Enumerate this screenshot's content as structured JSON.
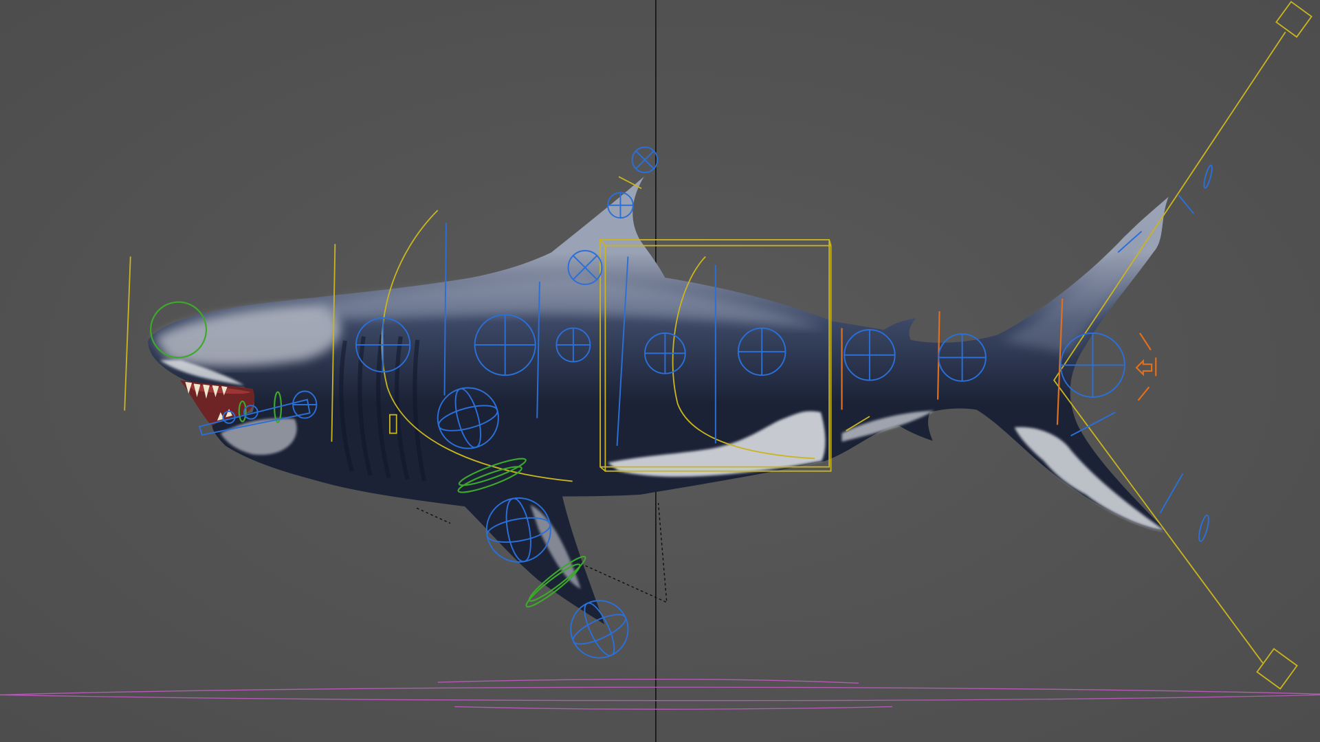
{
  "viewport": {
    "background_top": "#4c4c4c",
    "background_center": "#5a5a5a",
    "background_bottom": "#4e4e4e",
    "axis_line_color": "#141414"
  },
  "model": {
    "body_highlight": "#9aa2b5",
    "body_mid": "#3b4764",
    "body_dark": "#1b2236",
    "belly": "#d9dce1",
    "mouth": "#6e2424",
    "teeth": "#eee6cf"
  },
  "control_colors": {
    "blue": "#2b6fd8",
    "yellow": "#c9b520",
    "green": "#3da82b",
    "orange": "#e0701e",
    "magenta": "#b65ab6",
    "guide": "#111111"
  },
  "icons": [
    "crosshair-control-icon",
    "sphere-control-icon",
    "light-object-icon",
    "arrow-control-icon"
  ]
}
